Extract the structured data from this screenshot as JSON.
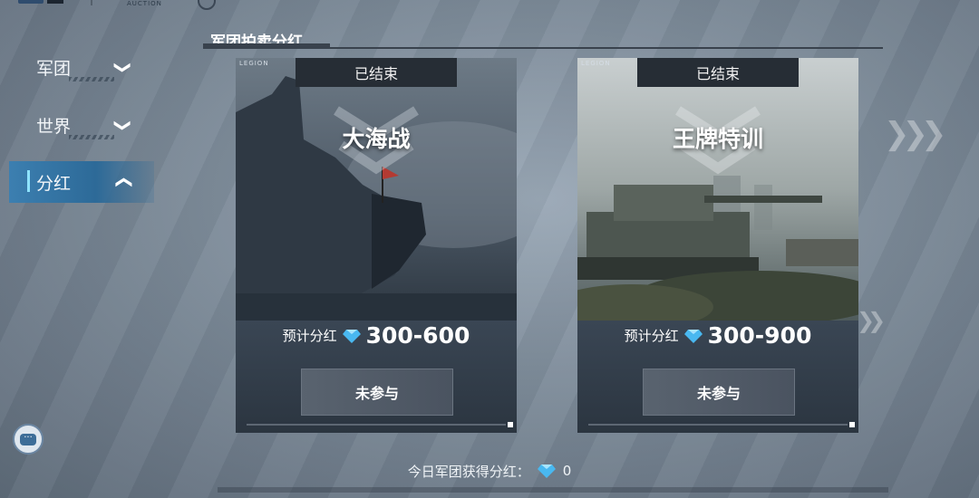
{
  "top": {
    "title": "",
    "subtitle": "AUCTION"
  },
  "sidebar": {
    "items": [
      {
        "label": "军团",
        "chevron": "chevron-down-icon",
        "chev_glyph": "❯"
      },
      {
        "label": "世界",
        "chevron": "chevron-down-icon",
        "chev_glyph": "❯"
      },
      {
        "label": "分红",
        "chevron": "chevron-up-icon",
        "chev_glyph": "❯",
        "active": true
      }
    ]
  },
  "section": {
    "title": "军团拍卖分红"
  },
  "cards": [
    {
      "legion_tag": "LEGION",
      "status": "已结束",
      "name": "大海战",
      "dividend_label": "预计分红",
      "dividend_range": "300-600",
      "button": "未参与",
      "accent": "#4f6a86"
    },
    {
      "legion_tag": "LEGION",
      "status": "已结束",
      "name": "王牌特训",
      "dividend_label": "预计分红",
      "dividend_range": "300-900",
      "button": "未参与",
      "accent": "#6b7a58"
    }
  ],
  "footer": {
    "label": "今日军团获得分红：",
    "value": "0"
  },
  "colors": {
    "active_tab": "#2d6a98",
    "indicator": "#8fe3ff",
    "gem": "#49b8f0"
  }
}
